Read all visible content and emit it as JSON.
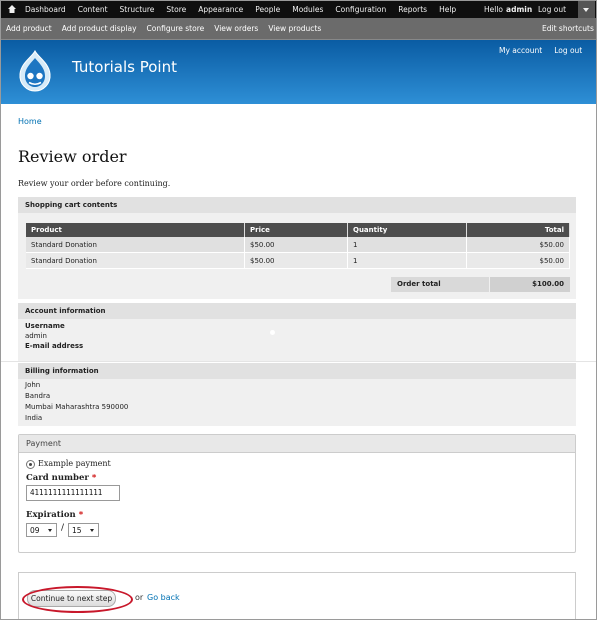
{
  "toolbar": {
    "menu": [
      "Dashboard",
      "Content",
      "Structure",
      "Store",
      "Appearance",
      "People",
      "Modules",
      "Configuration",
      "Reports",
      "Help"
    ],
    "hello_label": "Hello",
    "user_name": "admin",
    "logout": "Log out"
  },
  "shortcuts": {
    "items": [
      "Add product",
      "Add product display",
      "Configure store",
      "View orders",
      "View products"
    ],
    "edit": "Edit shortcuts"
  },
  "header": {
    "site_name": "Tutorials Point",
    "links": [
      "My account",
      "Log out"
    ]
  },
  "breadcrumb": "Home",
  "page_title": "Review order",
  "intro": "Review your order before continuing.",
  "cart": {
    "heading": "Shopping cart contents",
    "columns": [
      "Product",
      "Price",
      "Quantity",
      "Total"
    ],
    "rows": [
      [
        "Standard Donation",
        "$50.00",
        "1",
        "$50.00"
      ],
      [
        "Standard Donation",
        "$50.00",
        "1",
        "$50.00"
      ]
    ],
    "order_total_label": "Order total",
    "order_total_value": "$100.00"
  },
  "account": {
    "heading": "Account information",
    "username_label": "Username",
    "username_value": "admin",
    "email_label": "E-mail address"
  },
  "billing": {
    "heading": "Billing information",
    "lines": [
      "John",
      "Bandra",
      "Mumbai Maharashtra 590000",
      "India"
    ]
  },
  "payment": {
    "legend": "Payment",
    "method": "Example payment",
    "card_label": "Card number",
    "required_mark": "*",
    "card_value": "4111111111111111",
    "expiration_label": "Expiration",
    "month": "09",
    "separator": "/",
    "year": "15"
  },
  "actions": {
    "continue": "Continue to next step",
    "or": "or",
    "go_back": "Go back"
  },
  "colors": {
    "link": "#0071b3",
    "highlight_ring": "#c8182b",
    "header_top": "#0a5ca3",
    "header_bottom": "#2e8fd6"
  }
}
